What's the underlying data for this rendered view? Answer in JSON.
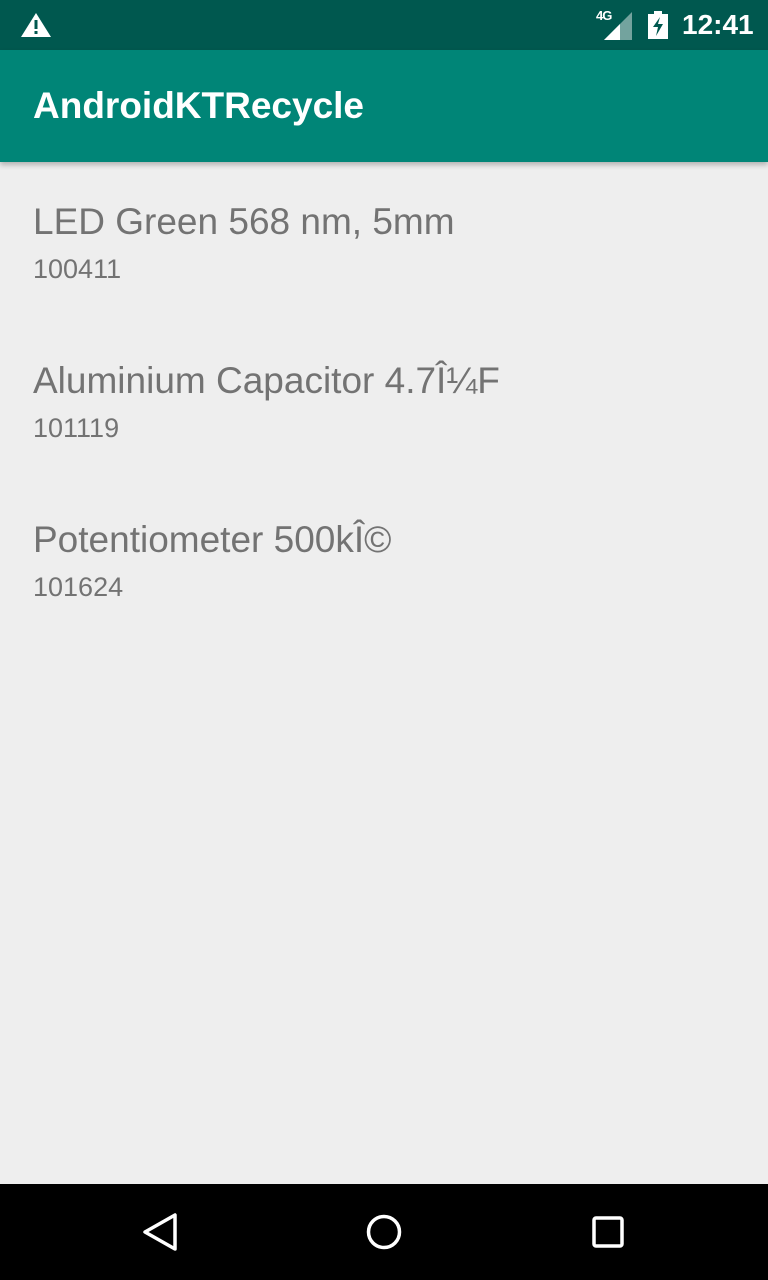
{
  "status_bar": {
    "warning_icon": "warning-icon",
    "network_label": "4G",
    "signal_icon": "cell-signal-icon",
    "battery_icon": "battery-charging-icon",
    "time": "12:41",
    "background": "#00584f"
  },
  "app_bar": {
    "title": "AndroidKTRecycle",
    "background": "#008577"
  },
  "items": [
    {
      "name": "LED Green 568 nm, 5mm",
      "code": "100411"
    },
    {
      "name": "Aluminium Capacitor 4.7Î¼F",
      "code": "101119"
    },
    {
      "name": "Potentiometer 500kÎ©",
      "code": "101624"
    }
  ],
  "nav_bar": {
    "back_icon": "back-triangle-icon",
    "home_icon": "home-circle-icon",
    "recents_icon": "recents-square-icon"
  },
  "colors": {
    "list_background": "#eeeeee",
    "text_secondary": "#737373"
  }
}
